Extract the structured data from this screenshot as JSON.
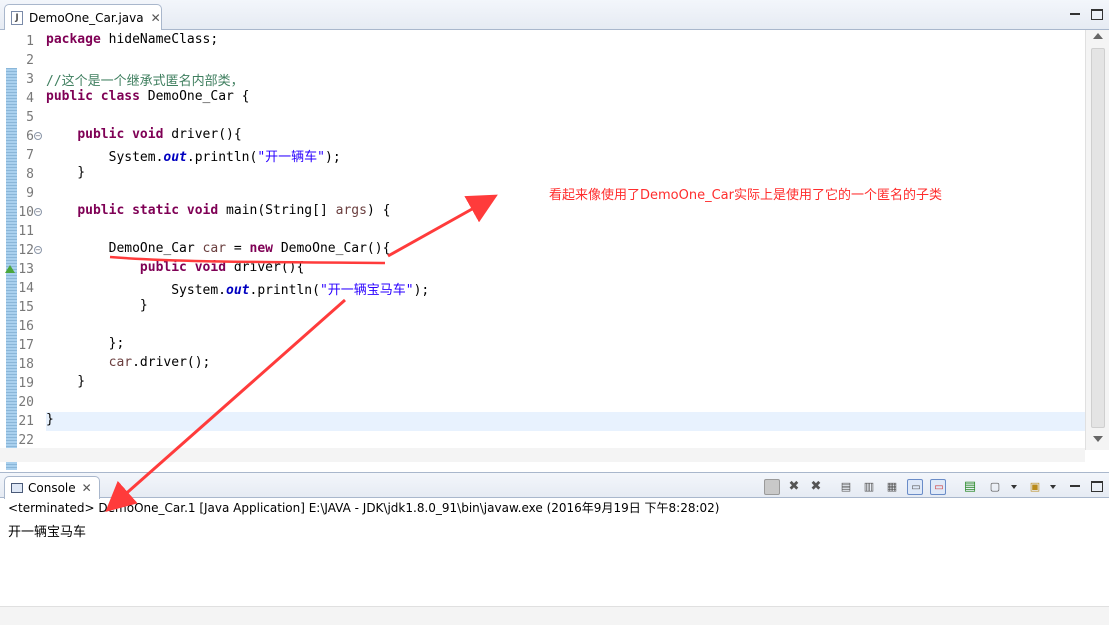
{
  "editor": {
    "tab": {
      "title": "DemoOne_Car.java",
      "icon": "java-file-icon",
      "close": "✕"
    },
    "lines": [
      {
        "n": "1",
        "segs": [
          [
            "kw",
            "package"
          ],
          [
            "pl",
            " hideNameClass;"
          ]
        ]
      },
      {
        "n": "2",
        "segs": []
      },
      {
        "n": "3",
        "segs": [
          [
            "cm",
            "//这个是一个继承式匿名内部类，"
          ]
        ]
      },
      {
        "n": "4",
        "segs": [
          [
            "kw",
            "public"
          ],
          [
            "pl",
            " "
          ],
          [
            "kw",
            "class"
          ],
          [
            "pl",
            " DemoOne_Car {"
          ]
        ]
      },
      {
        "n": "5",
        "segs": []
      },
      {
        "n": "6",
        "segs": [
          [
            "pl",
            "    "
          ],
          [
            "kw",
            "public"
          ],
          [
            "pl",
            " "
          ],
          [
            "kw",
            "void"
          ],
          [
            "pl",
            " driver(){"
          ]
        ]
      },
      {
        "n": "7",
        "segs": [
          [
            "pl",
            "        System."
          ],
          [
            "fld",
            "out"
          ],
          [
            "pl",
            ".println("
          ],
          [
            "str",
            "\"开一辆车\""
          ],
          [
            "pl",
            ");"
          ]
        ]
      },
      {
        "n": "8",
        "segs": [
          [
            "pl",
            "    }"
          ]
        ]
      },
      {
        "n": "9",
        "segs": []
      },
      {
        "n": "10",
        "segs": [
          [
            "pl",
            "    "
          ],
          [
            "kw",
            "public"
          ],
          [
            "pl",
            " "
          ],
          [
            "kw",
            "static"
          ],
          [
            "pl",
            " "
          ],
          [
            "kw",
            "void"
          ],
          [
            "pl",
            " main(String[] "
          ],
          [
            "loc",
            "args"
          ],
          [
            "pl",
            ") {"
          ]
        ]
      },
      {
        "n": "11",
        "segs": []
      },
      {
        "n": "12",
        "segs": [
          [
            "pl",
            "        DemoOne_Car "
          ],
          [
            "loc",
            "car"
          ],
          [
            "pl",
            " = "
          ],
          [
            "kw",
            "new"
          ],
          [
            "pl",
            " DemoOne_Car(){"
          ]
        ]
      },
      {
        "n": "13",
        "segs": [
          [
            "pl",
            "            "
          ],
          [
            "kw",
            "public"
          ],
          [
            "pl",
            " "
          ],
          [
            "kw",
            "void"
          ],
          [
            "pl",
            " driver(){"
          ]
        ]
      },
      {
        "n": "14",
        "segs": [
          [
            "pl",
            "                System."
          ],
          [
            "fld",
            "out"
          ],
          [
            "pl",
            ".println("
          ],
          [
            "str",
            "\"开一辆宝马车\""
          ],
          [
            "pl",
            ");"
          ]
        ]
      },
      {
        "n": "15",
        "segs": [
          [
            "pl",
            "            }"
          ]
        ]
      },
      {
        "n": "16",
        "segs": []
      },
      {
        "n": "17",
        "segs": [
          [
            "pl",
            "        };"
          ]
        ]
      },
      {
        "n": "18",
        "segs": [
          [
            "pl",
            "        "
          ],
          [
            "loc",
            "car"
          ],
          [
            "pl",
            ".driver();"
          ]
        ]
      },
      {
        "n": "19",
        "segs": [
          [
            "pl",
            "    }"
          ]
        ]
      },
      {
        "n": "20",
        "segs": []
      },
      {
        "n": "21",
        "segs": [
          [
            "pl",
            "}"
          ]
        ]
      },
      {
        "n": "22",
        "segs": []
      }
    ],
    "annotation": "看起来像使用了DemoOne_Car实际上是使用了它的一个匿名的子类"
  },
  "console": {
    "tab": {
      "title": "Console",
      "icon": "console-icon",
      "close": "✕"
    },
    "toolbar": [
      "terminate-icon",
      "remove-launch-icon",
      "remove-all-icon",
      "clear-console-icon",
      "scroll-lock-icon",
      "word-wrap-icon",
      "show-on-stdout-icon",
      "show-on-stderr-icon",
      "pin-console-icon",
      "display-selected-console-icon",
      "open-console-icon"
    ],
    "status": "<terminated> DemoOne_Car.1 [Java Application] E:\\JAVA - JDK\\jdk1.8.0_91\\bin\\javaw.exe (2016年9月19日 下午8:28:02)",
    "output": "开一辆宝马车"
  },
  "colors": {
    "keyword": "#7f0055",
    "comment": "#3f7f5f",
    "string": "#2a00ff",
    "field": "#0000c0",
    "annotation": "#ff2d2d"
  }
}
